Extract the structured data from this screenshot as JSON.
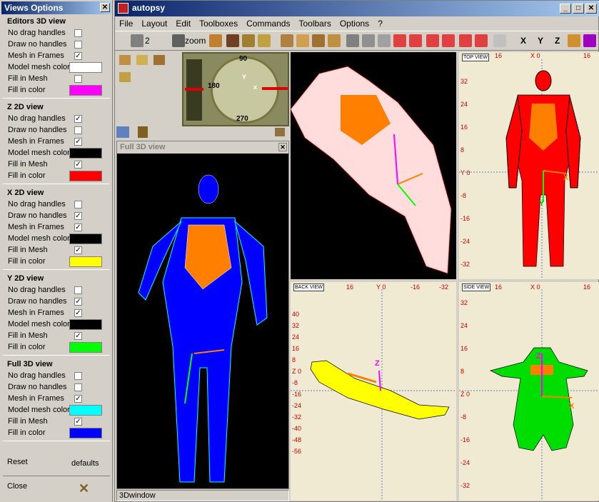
{
  "views_options": {
    "title": "Views Options",
    "sections": [
      {
        "title": "Editors 3D view",
        "rows": [
          {
            "label": "No drag handles",
            "type": "check",
            "checked": false
          },
          {
            "label": "Draw no handles",
            "type": "check",
            "checked": false
          },
          {
            "label": "Mesh in Frames",
            "type": "check",
            "checked": true
          },
          {
            "label": "Model mesh color",
            "type": "color",
            "color": "#ffffff"
          },
          {
            "label": "Fill in Mesh",
            "type": "check",
            "checked": false
          },
          {
            "label": "Fill in color",
            "type": "color",
            "color": "#ff00ff"
          }
        ]
      },
      {
        "title": "Z 2D view",
        "rows": [
          {
            "label": "No drag handles",
            "type": "check",
            "checked": true
          },
          {
            "label": "Draw no handles",
            "type": "check",
            "checked": false
          },
          {
            "label": "Mesh in Frames",
            "type": "check",
            "checked": true
          },
          {
            "label": "Model mesh color",
            "type": "color",
            "color": "#000000"
          },
          {
            "label": "Fill in Mesh",
            "type": "check",
            "checked": true
          },
          {
            "label": "Fill in color",
            "type": "color",
            "color": "#ff0000"
          }
        ]
      },
      {
        "title": "X 2D view",
        "rows": [
          {
            "label": "No drag handles",
            "type": "check",
            "checked": false
          },
          {
            "label": "Draw no handles",
            "type": "check",
            "checked": true
          },
          {
            "label": "Mesh in Frames",
            "type": "check",
            "checked": true
          },
          {
            "label": "Model mesh color",
            "type": "color",
            "color": "#000000"
          },
          {
            "label": "Fill in Mesh",
            "type": "check",
            "checked": true
          },
          {
            "label": "Fill in color",
            "type": "color",
            "color": "#ffff00"
          }
        ]
      },
      {
        "title": "Y 2D view",
        "rows": [
          {
            "label": "No drag handles",
            "type": "check",
            "checked": false
          },
          {
            "label": "Draw no handles",
            "type": "check",
            "checked": true
          },
          {
            "label": "Mesh in Frames",
            "type": "check",
            "checked": true
          },
          {
            "label": "Model mesh color",
            "type": "color",
            "color": "#000000"
          },
          {
            "label": "Fill in Mesh",
            "type": "check",
            "checked": true
          },
          {
            "label": "Fill in color",
            "type": "color",
            "color": "#00ff00"
          }
        ]
      },
      {
        "title": "Full 3D view",
        "rows": [
          {
            "label": "No drag handles",
            "type": "check",
            "checked": false
          },
          {
            "label": "Draw no handles",
            "type": "check",
            "checked": false
          },
          {
            "label": "Mesh in Frames",
            "type": "check",
            "checked": true
          },
          {
            "label": "Model mesh color",
            "type": "color",
            "color": "#00ffff"
          },
          {
            "label": "Fill in Mesh",
            "type": "check",
            "checked": true
          },
          {
            "label": "Fill in color",
            "type": "color",
            "color": "#0000ff"
          }
        ]
      }
    ],
    "reset_label": "Reset",
    "defaults_label": "defaults",
    "close_label": "Close"
  },
  "app": {
    "title": "autopsy",
    "menu": [
      "File",
      "Layout",
      "Edit",
      "Toolboxes",
      "Commands",
      "Toolbars",
      "Options",
      "?"
    ],
    "toolbar": {
      "count": "2",
      "zoom": "zoom",
      "axes": [
        "X",
        "Y",
        "Z"
      ]
    },
    "compass": {
      "north": "90",
      "south": "270",
      "west": "180",
      "x_label": "x",
      "y_label": "Y"
    },
    "full3d_title": "Full 3D view",
    "status_label": "3Dwindow",
    "top_view": {
      "label": "TOP VIEW",
      "top_ticks": [
        "16",
        "X 0",
        "16"
      ],
      "y_ticks": [
        "32",
        "24",
        "16",
        "8",
        "Y 0",
        "-8",
        "-16",
        "-24",
        "-32"
      ]
    },
    "back_view": {
      "label": "BACK VIEW",
      "top_ticks": [
        "16",
        "Y 0",
        "-16",
        "-32"
      ],
      "y_ticks": [
        "40",
        "32",
        "24",
        "16",
        "8",
        "Z 0",
        "-8",
        "-16",
        "-24",
        "-32",
        "-40",
        "-48",
        "-56"
      ]
    },
    "side_view": {
      "label": "SIDE VIEW",
      "top_ticks": [
        "16",
        "X 0",
        "16"
      ],
      "y_ticks": [
        "32",
        "24",
        "16",
        "8",
        "Z 0",
        "-8",
        "-16",
        "-24",
        "-32"
      ]
    },
    "axis_letters": {
      "x": "X",
      "y": "Y",
      "z": "Z"
    }
  }
}
